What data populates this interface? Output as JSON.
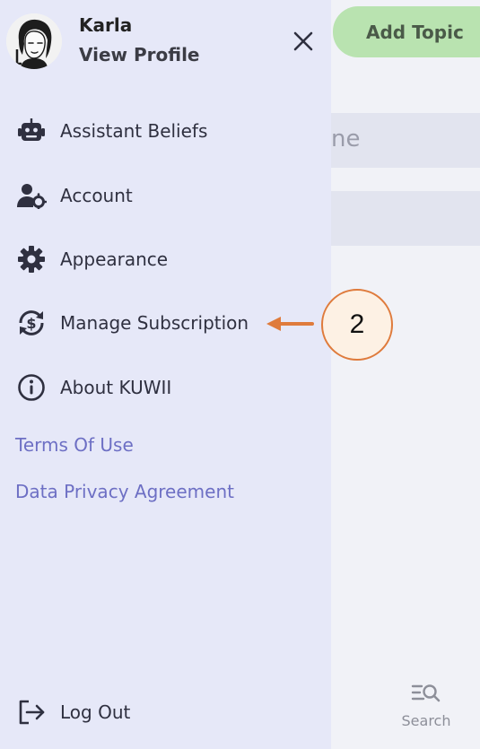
{
  "background": {
    "add_topic_label": "Add Topic",
    "field_fragment": "ne",
    "search_label": "Search"
  },
  "drawer": {
    "user_name": "Karla",
    "view_profile": "View Profile",
    "menu": [
      {
        "label": "Assistant Beliefs",
        "icon": "robot-icon"
      },
      {
        "label": "Account",
        "icon": "user-gear-icon"
      },
      {
        "label": "Appearance",
        "icon": "gear-icon"
      },
      {
        "label": "Manage Subscription",
        "icon": "dollar-refresh-icon"
      },
      {
        "label": "About KUWII",
        "icon": "info-icon"
      }
    ],
    "links": {
      "terms": "Terms Of Use",
      "privacy": "Data Privacy Agreement"
    },
    "logout": "Log Out"
  },
  "annotation": {
    "number": "2",
    "color": "#df7b3c"
  }
}
